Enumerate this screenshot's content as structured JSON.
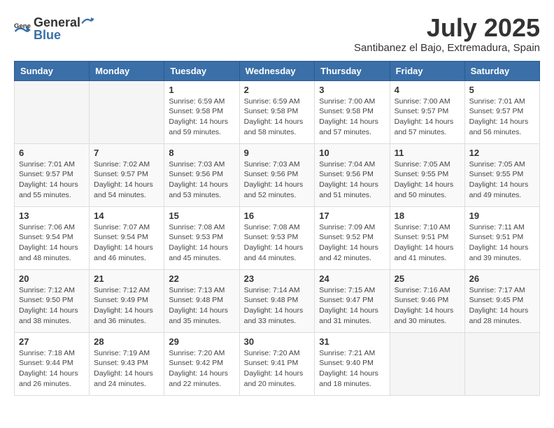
{
  "header": {
    "logo_general": "General",
    "logo_blue": "Blue",
    "month": "July 2025",
    "location": "Santibanez el Bajo, Extremadura, Spain"
  },
  "columns": [
    "Sunday",
    "Monday",
    "Tuesday",
    "Wednesday",
    "Thursday",
    "Friday",
    "Saturday"
  ],
  "weeks": [
    [
      {
        "day": "",
        "sunrise": "",
        "sunset": "",
        "daylight": ""
      },
      {
        "day": "",
        "sunrise": "",
        "sunset": "",
        "daylight": ""
      },
      {
        "day": "1",
        "sunrise": "Sunrise: 6:59 AM",
        "sunset": "Sunset: 9:58 PM",
        "daylight": "Daylight: 14 hours and 59 minutes."
      },
      {
        "day": "2",
        "sunrise": "Sunrise: 6:59 AM",
        "sunset": "Sunset: 9:58 PM",
        "daylight": "Daylight: 14 hours and 58 minutes."
      },
      {
        "day": "3",
        "sunrise": "Sunrise: 7:00 AM",
        "sunset": "Sunset: 9:58 PM",
        "daylight": "Daylight: 14 hours and 57 minutes."
      },
      {
        "day": "4",
        "sunrise": "Sunrise: 7:00 AM",
        "sunset": "Sunset: 9:57 PM",
        "daylight": "Daylight: 14 hours and 57 minutes."
      },
      {
        "day": "5",
        "sunrise": "Sunrise: 7:01 AM",
        "sunset": "Sunset: 9:57 PM",
        "daylight": "Daylight: 14 hours and 56 minutes."
      }
    ],
    [
      {
        "day": "6",
        "sunrise": "Sunrise: 7:01 AM",
        "sunset": "Sunset: 9:57 PM",
        "daylight": "Daylight: 14 hours and 55 minutes."
      },
      {
        "day": "7",
        "sunrise": "Sunrise: 7:02 AM",
        "sunset": "Sunset: 9:57 PM",
        "daylight": "Daylight: 14 hours and 54 minutes."
      },
      {
        "day": "8",
        "sunrise": "Sunrise: 7:03 AM",
        "sunset": "Sunset: 9:56 PM",
        "daylight": "Daylight: 14 hours and 53 minutes."
      },
      {
        "day": "9",
        "sunrise": "Sunrise: 7:03 AM",
        "sunset": "Sunset: 9:56 PM",
        "daylight": "Daylight: 14 hours and 52 minutes."
      },
      {
        "day": "10",
        "sunrise": "Sunrise: 7:04 AM",
        "sunset": "Sunset: 9:56 PM",
        "daylight": "Daylight: 14 hours and 51 minutes."
      },
      {
        "day": "11",
        "sunrise": "Sunrise: 7:05 AM",
        "sunset": "Sunset: 9:55 PM",
        "daylight": "Daylight: 14 hours and 50 minutes."
      },
      {
        "day": "12",
        "sunrise": "Sunrise: 7:05 AM",
        "sunset": "Sunset: 9:55 PM",
        "daylight": "Daylight: 14 hours and 49 minutes."
      }
    ],
    [
      {
        "day": "13",
        "sunrise": "Sunrise: 7:06 AM",
        "sunset": "Sunset: 9:54 PM",
        "daylight": "Daylight: 14 hours and 48 minutes."
      },
      {
        "day": "14",
        "sunrise": "Sunrise: 7:07 AM",
        "sunset": "Sunset: 9:54 PM",
        "daylight": "Daylight: 14 hours and 46 minutes."
      },
      {
        "day": "15",
        "sunrise": "Sunrise: 7:08 AM",
        "sunset": "Sunset: 9:53 PM",
        "daylight": "Daylight: 14 hours and 45 minutes."
      },
      {
        "day": "16",
        "sunrise": "Sunrise: 7:08 AM",
        "sunset": "Sunset: 9:53 PM",
        "daylight": "Daylight: 14 hours and 44 minutes."
      },
      {
        "day": "17",
        "sunrise": "Sunrise: 7:09 AM",
        "sunset": "Sunset: 9:52 PM",
        "daylight": "Daylight: 14 hours and 42 minutes."
      },
      {
        "day": "18",
        "sunrise": "Sunrise: 7:10 AM",
        "sunset": "Sunset: 9:51 PM",
        "daylight": "Daylight: 14 hours and 41 minutes."
      },
      {
        "day": "19",
        "sunrise": "Sunrise: 7:11 AM",
        "sunset": "Sunset: 9:51 PM",
        "daylight": "Daylight: 14 hours and 39 minutes."
      }
    ],
    [
      {
        "day": "20",
        "sunrise": "Sunrise: 7:12 AM",
        "sunset": "Sunset: 9:50 PM",
        "daylight": "Daylight: 14 hours and 38 minutes."
      },
      {
        "day": "21",
        "sunrise": "Sunrise: 7:12 AM",
        "sunset": "Sunset: 9:49 PM",
        "daylight": "Daylight: 14 hours and 36 minutes."
      },
      {
        "day": "22",
        "sunrise": "Sunrise: 7:13 AM",
        "sunset": "Sunset: 9:48 PM",
        "daylight": "Daylight: 14 hours and 35 minutes."
      },
      {
        "day": "23",
        "sunrise": "Sunrise: 7:14 AM",
        "sunset": "Sunset: 9:48 PM",
        "daylight": "Daylight: 14 hours and 33 minutes."
      },
      {
        "day": "24",
        "sunrise": "Sunrise: 7:15 AM",
        "sunset": "Sunset: 9:47 PM",
        "daylight": "Daylight: 14 hours and 31 minutes."
      },
      {
        "day": "25",
        "sunrise": "Sunrise: 7:16 AM",
        "sunset": "Sunset: 9:46 PM",
        "daylight": "Daylight: 14 hours and 30 minutes."
      },
      {
        "day": "26",
        "sunrise": "Sunrise: 7:17 AM",
        "sunset": "Sunset: 9:45 PM",
        "daylight": "Daylight: 14 hours and 28 minutes."
      }
    ],
    [
      {
        "day": "27",
        "sunrise": "Sunrise: 7:18 AM",
        "sunset": "Sunset: 9:44 PM",
        "daylight": "Daylight: 14 hours and 26 minutes."
      },
      {
        "day": "28",
        "sunrise": "Sunrise: 7:19 AM",
        "sunset": "Sunset: 9:43 PM",
        "daylight": "Daylight: 14 hours and 24 minutes."
      },
      {
        "day": "29",
        "sunrise": "Sunrise: 7:20 AM",
        "sunset": "Sunset: 9:42 PM",
        "daylight": "Daylight: 14 hours and 22 minutes."
      },
      {
        "day": "30",
        "sunrise": "Sunrise: 7:20 AM",
        "sunset": "Sunset: 9:41 PM",
        "daylight": "Daylight: 14 hours and 20 minutes."
      },
      {
        "day": "31",
        "sunrise": "Sunrise: 7:21 AM",
        "sunset": "Sunset: 9:40 PM",
        "daylight": "Daylight: 14 hours and 18 minutes."
      },
      {
        "day": "",
        "sunrise": "",
        "sunset": "",
        "daylight": ""
      },
      {
        "day": "",
        "sunrise": "",
        "sunset": "",
        "daylight": ""
      }
    ]
  ]
}
